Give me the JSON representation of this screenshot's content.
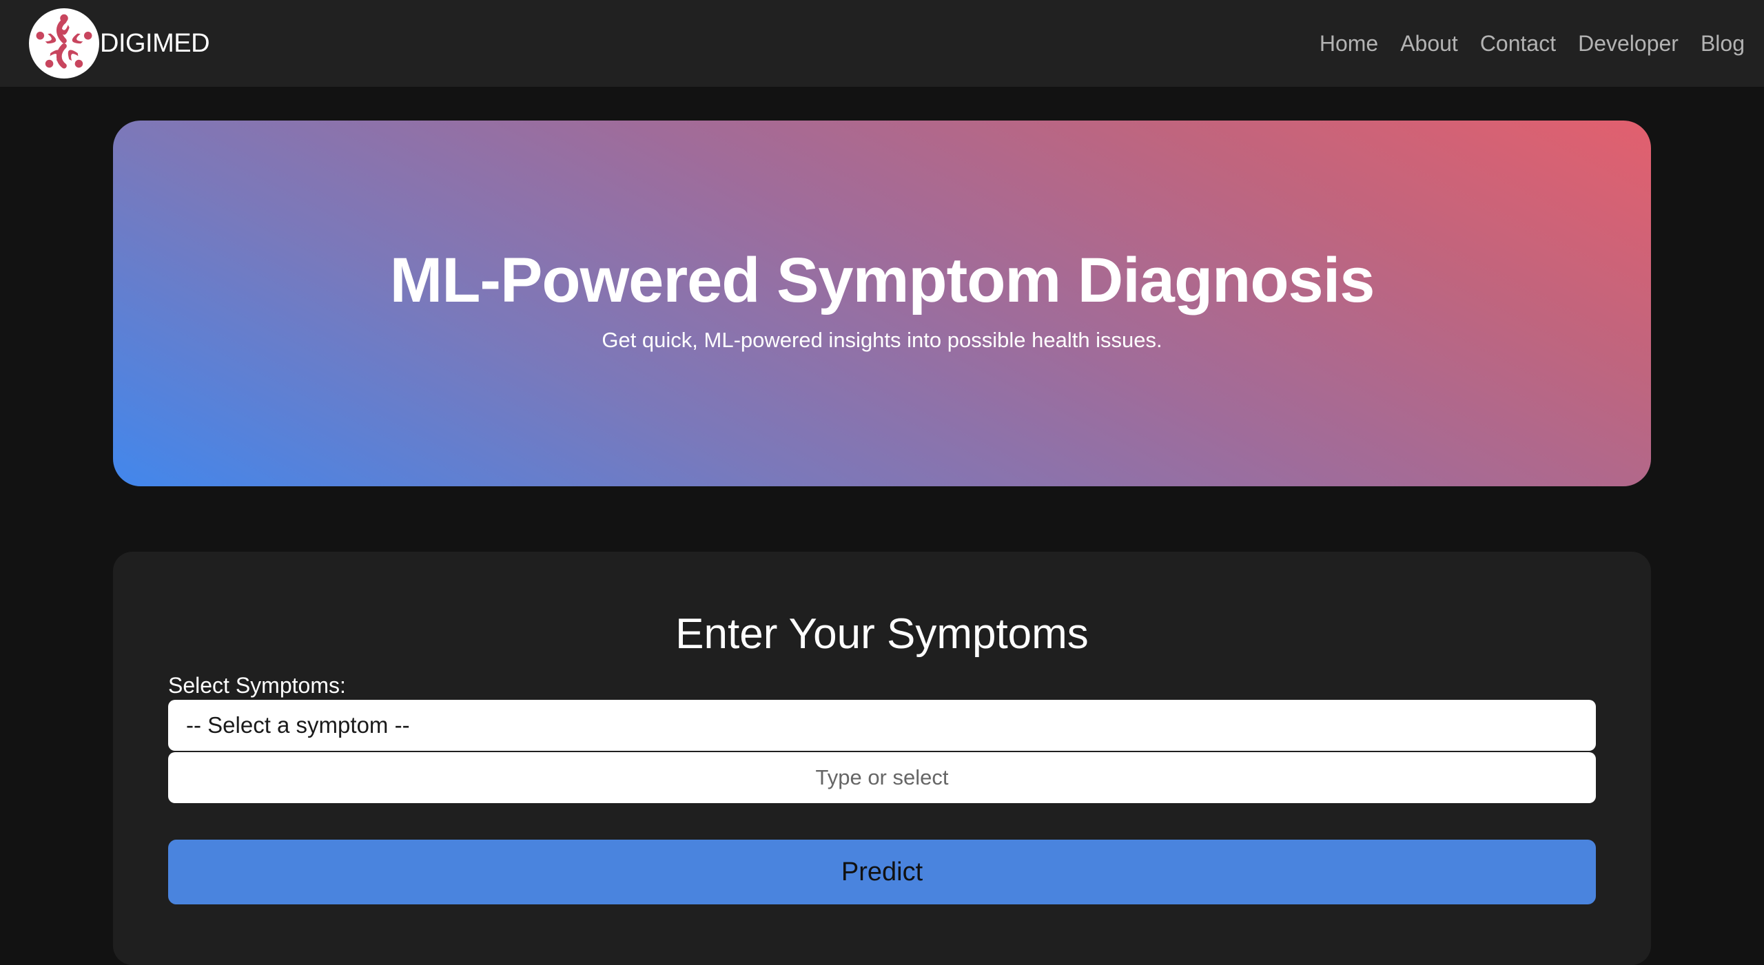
{
  "navbar": {
    "brand": "DIGIMED",
    "logo_icon": "digimed-logo-icon",
    "links": [
      "Home",
      "About",
      "Contact",
      "Developer",
      "Blog"
    ]
  },
  "hero": {
    "title": "ML-Powered Symptom Diagnosis",
    "subtitle": "Get quick, ML-powered insights into possible health issues.",
    "gradient_colors": [
      "#4287ec",
      "#a06c9a",
      "#e2606e"
    ]
  },
  "form": {
    "title": "Enter Your Symptoms",
    "label": "Select Symptoms:",
    "select_value": "-- Select a symptom --",
    "input_placeholder": "Type or select",
    "button_label": "Predict",
    "button_color": "#4a84de"
  },
  "colors": {
    "page_background": "#121212",
    "navbar_background": "#212121",
    "card_background": "#1f1f1f",
    "logo_accent": "#c8455e"
  }
}
